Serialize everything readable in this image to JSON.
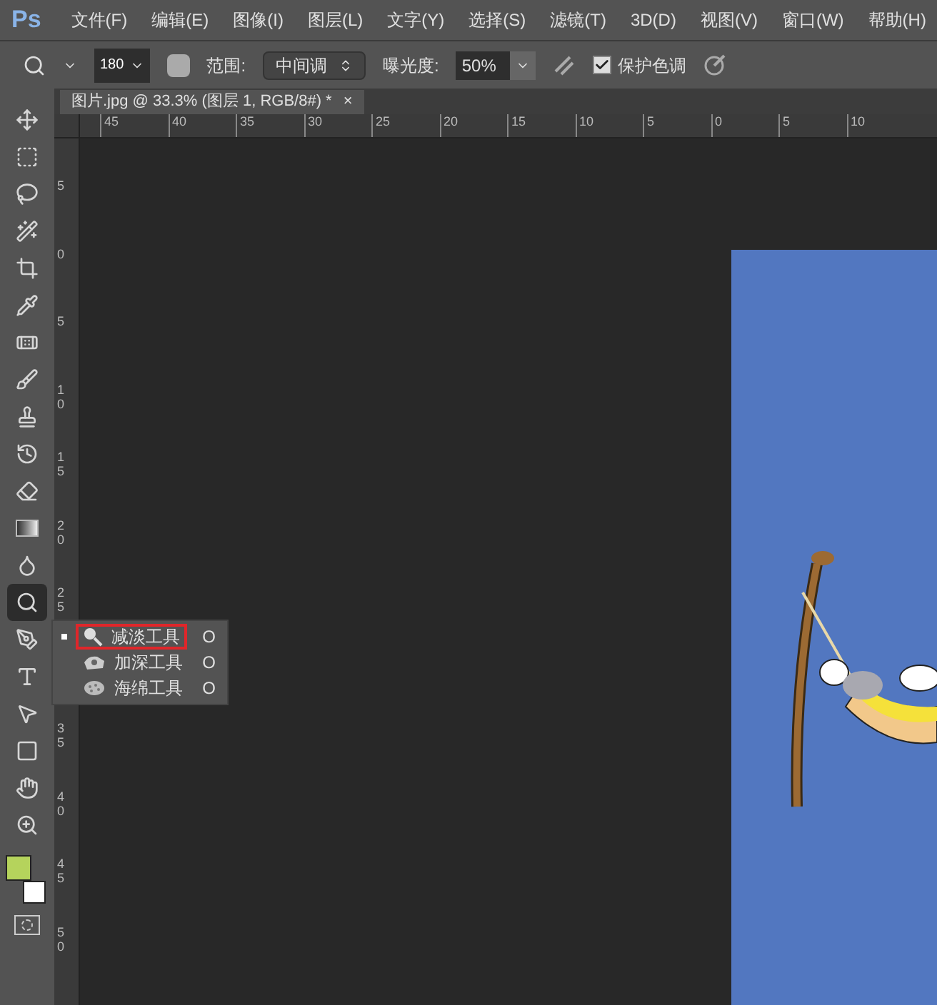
{
  "menu": {
    "logo": "Ps",
    "items": [
      "文件(F)",
      "编辑(E)",
      "图像(I)",
      "图层(L)",
      "文字(Y)",
      "选择(S)",
      "滤镜(T)",
      "3D(D)",
      "视图(V)",
      "窗口(W)",
      "帮助(H)"
    ]
  },
  "options_bar": {
    "brush_size": "180",
    "range_label": "范围:",
    "range_value": "中间调",
    "exposure_label": "曝光度:",
    "exposure_value": "50%",
    "protect_tones": {
      "label": "保护色调",
      "checked": true
    }
  },
  "document_tab": {
    "title": "图片.jpg @ 33.3% (图层 1, RGB/8#) *",
    "close": "×"
  },
  "horizontal_ruler": [
    "45",
    "40",
    "35",
    "30",
    "25",
    "20",
    "15",
    "10",
    "5",
    "0",
    "5",
    "10"
  ],
  "vertical_ruler_upper": [
    "5",
    "0",
    "5",
    "10",
    "15",
    "20",
    "25"
  ],
  "vertical_ruler_lower": [
    "35",
    "40",
    "45",
    "50"
  ],
  "tools": [
    {
      "kind": "move",
      "selected": false
    },
    {
      "kind": "marquee",
      "selected": false
    },
    {
      "kind": "lasso",
      "selected": false
    },
    {
      "kind": "wand",
      "selected": false
    },
    {
      "kind": "crop",
      "selected": false
    },
    {
      "kind": "eyedropper",
      "selected": false
    },
    {
      "kind": "healing",
      "selected": false
    },
    {
      "kind": "brush",
      "selected": false
    },
    {
      "kind": "stamp",
      "selected": false
    },
    {
      "kind": "history",
      "selected": false
    },
    {
      "kind": "eraser",
      "selected": false
    },
    {
      "kind": "gradient",
      "selected": false
    },
    {
      "kind": "blur",
      "selected": false
    },
    {
      "kind": "dodge",
      "selected": true
    },
    {
      "kind": "pen",
      "selected": false
    },
    {
      "kind": "type",
      "selected": false
    },
    {
      "kind": "path",
      "selected": false
    },
    {
      "kind": "shape",
      "selected": false
    },
    {
      "kind": "hand",
      "selected": false
    },
    {
      "kind": "zoom",
      "selected": false
    }
  ],
  "color_swatches": [
    {
      "kind": "foreground",
      "color": "#b5d35c"
    },
    {
      "kind": "background",
      "color": "#ffffff"
    }
  ],
  "tool_flyout": [
    {
      "kind": "dodge",
      "label": "减淡工具",
      "shortcut": "O",
      "selected": true
    },
    {
      "kind": "burn",
      "label": "加深工具",
      "shortcut": "O",
      "selected": false
    },
    {
      "kind": "sponge",
      "label": "海绵工具",
      "shortcut": "O",
      "selected": false
    }
  ]
}
